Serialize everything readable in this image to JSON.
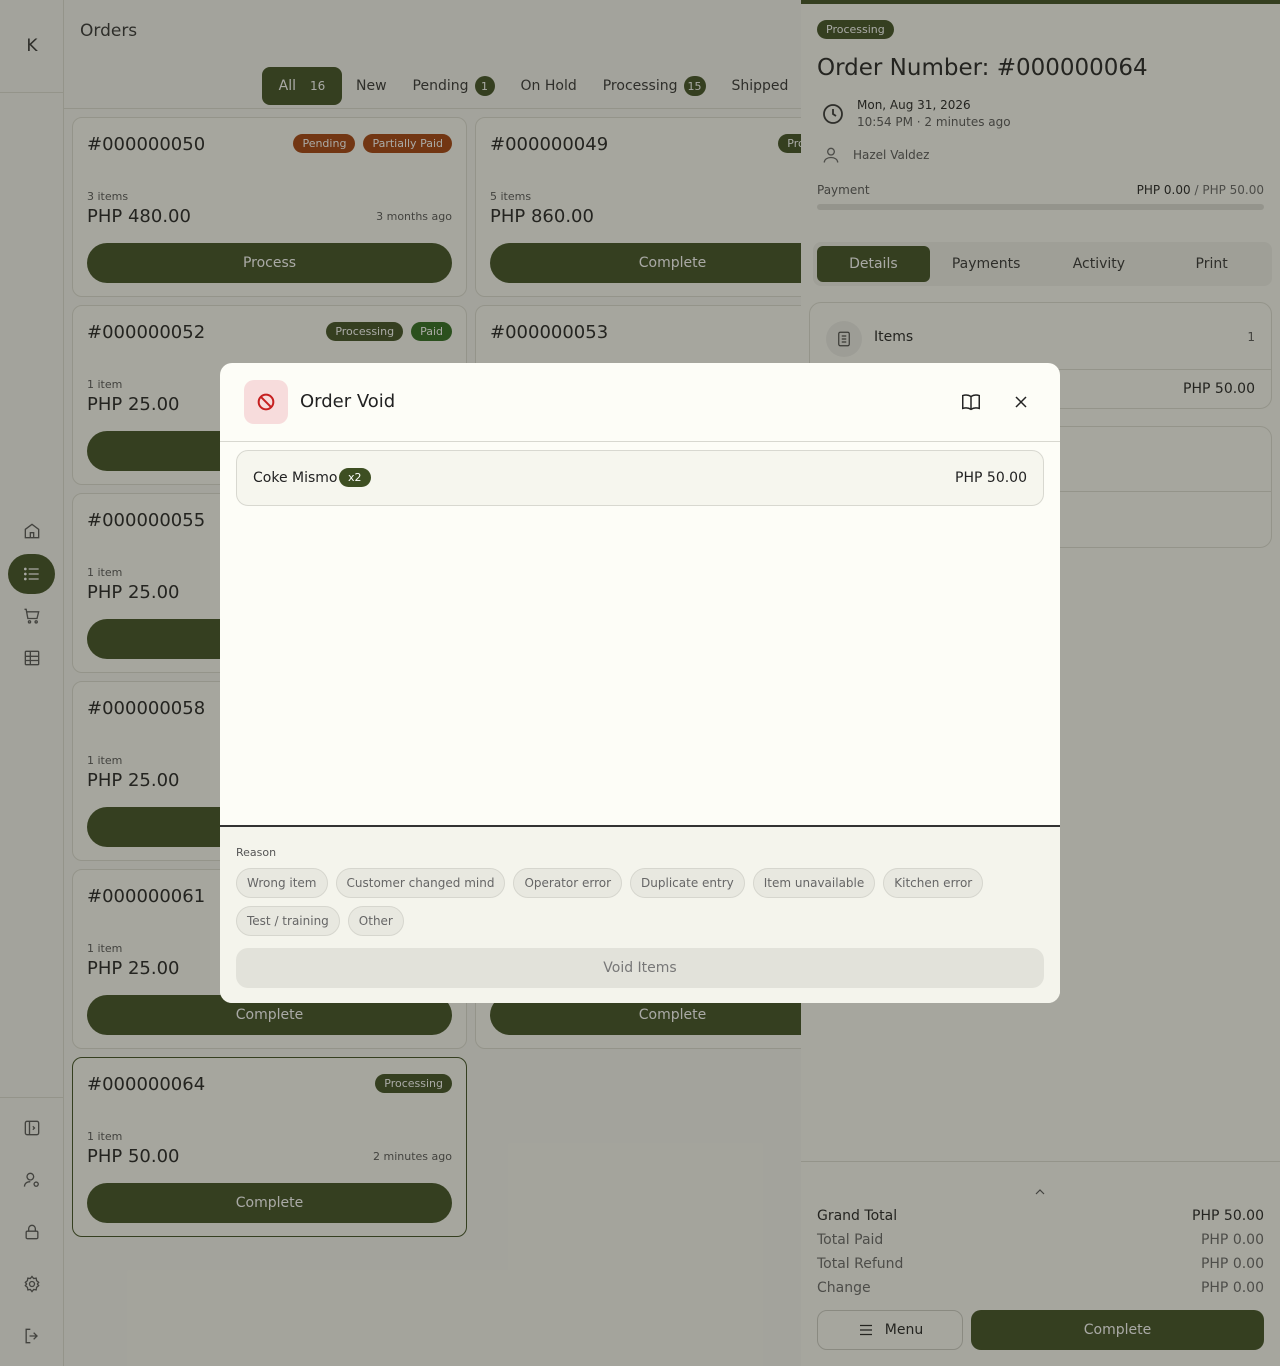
{
  "sidebar": {
    "logo": "K",
    "nav": [
      "home-icon",
      "list-icon",
      "cart-icon",
      "table-icon"
    ],
    "bottom": [
      "panel-icon",
      "user-settings-icon",
      "lock-icon",
      "gear-icon",
      "logout-icon"
    ]
  },
  "main": {
    "title": "Orders",
    "tabs": [
      {
        "label": "All",
        "count": "16"
      },
      {
        "label": "New"
      },
      {
        "label": "Pending",
        "count": "1"
      },
      {
        "label": "On Hold"
      },
      {
        "label": "Processing",
        "count": "15"
      },
      {
        "label": "Shipped"
      }
    ],
    "cards": [
      {
        "number": "#000000050",
        "badges": [
          "Pending",
          "Partially Paid"
        ],
        "items": "3 items",
        "price": "PHP 480.00",
        "ago": "3 months ago",
        "action": "Process"
      },
      {
        "number": "#000000049",
        "badges": [
          "Processing"
        ],
        "items": "5 items",
        "price": "PHP 860.00",
        "ago": "",
        "action": "Complete"
      },
      {
        "number": "#000000052",
        "badges": [
          "Processing",
          "Paid"
        ],
        "items": "1 item",
        "price": "PHP 25.00",
        "ago": "",
        "action": ""
      },
      {
        "number": "#000000053",
        "badges": [
          "Pr"
        ],
        "items": "",
        "price": "",
        "ago": "",
        "action": ""
      },
      {
        "number": "#000000055",
        "badges": [],
        "items": "1 item",
        "price": "PHP 25.00",
        "ago": "",
        "action": ""
      },
      {
        "number": "#000000058",
        "badges": [],
        "items": "1 item",
        "price": "PHP 25.00",
        "ago": "",
        "action": ""
      },
      {
        "number": "#000000061",
        "badges": [],
        "items": "1 item",
        "price": "PHP 25.00",
        "ago": "",
        "action": "Complete"
      },
      {
        "number": "",
        "badges": [],
        "items": "",
        "price": "",
        "ago": "",
        "action": "Complete"
      },
      {
        "number": "#000000064",
        "badges": [
          "Processing"
        ],
        "items": "1 item",
        "price": "PHP 50.00",
        "ago": "2 minutes ago",
        "action": "Complete"
      }
    ]
  },
  "detail": {
    "status": "Processing",
    "title": "Order Number: #000000064",
    "date": "Mon, Aug 31, 2026",
    "time": "10:54 PM · 2 minutes ago",
    "customer": "Hazel Valdez",
    "payment_label": "Payment",
    "paid": "PHP 0.00",
    "separator": "/",
    "total": "PHP 50.00",
    "payment_progress": 0,
    "tabs": [
      "Details",
      "Payments",
      "Activity",
      "Print"
    ],
    "items_label": "Items",
    "items_count": "1",
    "items_total": "PHP 50.00",
    "totals": [
      {
        "label": "Grand Total",
        "value": "PHP 50.00"
      },
      {
        "label": "Total Paid",
        "value": "PHP 0.00"
      },
      {
        "label": "Total Refund",
        "value": "PHP 0.00"
      },
      {
        "label": "Change",
        "value": "PHP 0.00"
      }
    ],
    "menu_label": "Menu",
    "complete_label": "Complete"
  },
  "modal": {
    "title": "Order Void",
    "item_name": "Coke Mismo",
    "item_qty": "x2",
    "item_price": "PHP 50.00",
    "reason_label": "Reason",
    "reasons": [
      "Wrong item",
      "Customer changed mind",
      "Operator error",
      "Duplicate entry",
      "Item unavailable",
      "Kitchen error",
      "Test / training",
      "Other"
    ],
    "void_label": "Void Items"
  },
  "colors": {
    "primary": "#3e4f22",
    "pending": "#a3400c",
    "danger": "#c62020"
  }
}
